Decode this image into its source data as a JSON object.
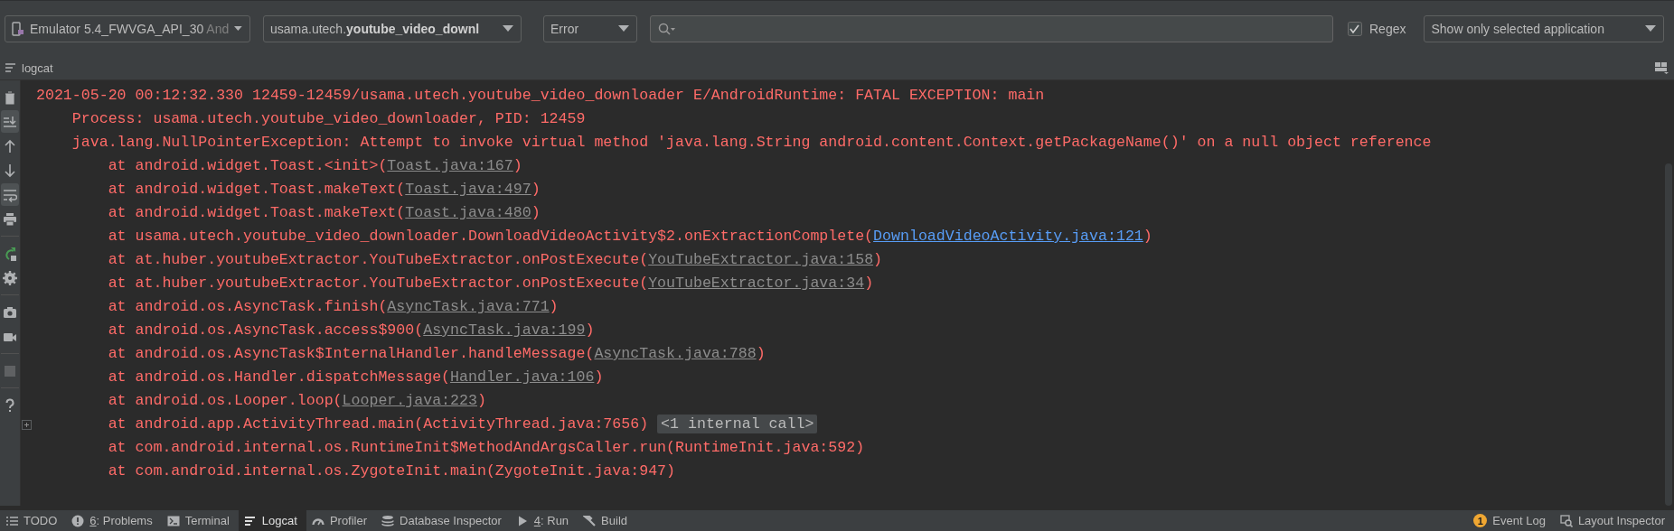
{
  "device_selector": {
    "label": "Emulator 5.4_FWVGA_API_30",
    "cut_text": "And"
  },
  "package_selector": {
    "label": "usama.utech.**youtube_video_downl**"
  },
  "level_selector": {
    "label": "Error"
  },
  "regex": {
    "label": "Regex",
    "checked": true
  },
  "filter_selector": {
    "label": "Show only selected application"
  },
  "panel_title": "logcat",
  "side_tool_groups": [
    [
      {
        "kind": "trash",
        "on": false,
        "disabled": false
      },
      {
        "kind": "scroll-end",
        "on": true,
        "disabled": false
      },
      {
        "kind": "up",
        "on": false,
        "disabled": false
      },
      {
        "kind": "down",
        "on": false,
        "disabled": false
      },
      {
        "kind": "wrap",
        "on": true,
        "disabled": false
      },
      {
        "kind": "print",
        "on": false,
        "disabled": false
      }
    ],
    [
      {
        "kind": "restart",
        "on": false,
        "disabled": false
      },
      {
        "kind": "gear",
        "on": false,
        "disabled": false
      }
    ],
    [
      {
        "kind": "camera",
        "on": false,
        "disabled": false
      },
      {
        "kind": "video",
        "on": false,
        "disabled": false
      }
    ],
    [
      {
        "kind": "stop",
        "on": false,
        "disabled": true
      }
    ],
    [
      {
        "kind": "help",
        "on": false,
        "disabled": false
      }
    ]
  ],
  "log_lines": [
    {
      "kind": "header",
      "text": "2021-05-20 00:12:32.330 12459-12459/usama.utech.youtube_video_downloader E/AndroidRuntime: FATAL EXCEPTION: main",
      "folded": false
    },
    {
      "kind": "cause",
      "text": "Process: usama.utech.youtube_video_downloader, PID: 12459",
      "folded": false
    },
    {
      "kind": "cause",
      "text": "java.lang.NullPointerException: Attempt to invoke virtual method 'java.lang.String android.content.Context.getPackageName()' on a null object reference",
      "folded": false
    },
    {
      "kind": "frame",
      "text": "at android.widget.Toast.<init>(",
      "link": {
        "kind": "library",
        "text": "Toast.java:167"
      },
      "tail": ")",
      "folded": false
    },
    {
      "kind": "frame",
      "text": "at android.widget.Toast.makeText(",
      "link": {
        "kind": "library",
        "text": "Toast.java:497"
      },
      "tail": ")",
      "folded": false
    },
    {
      "kind": "frame",
      "text": "at android.widget.Toast.makeText(",
      "link": {
        "kind": "library",
        "text": "Toast.java:480"
      },
      "tail": ")",
      "folded": false
    },
    {
      "kind": "frame",
      "text": "at usama.utech.youtube_video_downloader.DownloadVideoActivity$2.onExtractionComplete(",
      "link": {
        "kind": "project",
        "text": "DownloadVideoActivity.java:121"
      },
      "tail": ")",
      "folded": false
    },
    {
      "kind": "frame",
      "text": "at at.huber.youtubeExtractor.YouTubeExtractor.onPostExecute(",
      "link": {
        "kind": "library",
        "text": "YouTubeExtractor.java:158"
      },
      "tail": ")",
      "folded": false
    },
    {
      "kind": "frame",
      "text": "at at.huber.youtubeExtractor.YouTubeExtractor.onPostExecute(",
      "link": {
        "kind": "library",
        "text": "YouTubeExtractor.java:34"
      },
      "tail": ")",
      "folded": false
    },
    {
      "kind": "frame",
      "text": "at android.os.AsyncTask.finish(",
      "link": {
        "kind": "library",
        "text": "AsyncTask.java:771"
      },
      "tail": ")",
      "folded": false
    },
    {
      "kind": "frame",
      "text": "at android.os.AsyncTask.access$900(",
      "link": {
        "kind": "library",
        "text": "AsyncTask.java:199"
      },
      "tail": ")",
      "folded": false
    },
    {
      "kind": "frame",
      "text": "at android.os.AsyncTask$InternalHandler.handleMessage(",
      "link": {
        "kind": "library",
        "text": "AsyncTask.java:788"
      },
      "tail": ")",
      "folded": false
    },
    {
      "kind": "frame",
      "text": "at android.os.Handler.dispatchMessage(",
      "link": {
        "kind": "library",
        "text": "Handler.java:106"
      },
      "tail": ")",
      "folded": false
    },
    {
      "kind": "frame",
      "text": "at android.os.Looper.loop(",
      "link": {
        "kind": "library",
        "text": "Looper.java:223"
      },
      "tail": ")",
      "folded": false
    },
    {
      "kind": "frame",
      "text": "at android.app.ActivityThread.main(ActivityThread.java:7656)",
      "badge": "<1 internal call>",
      "folded": true
    },
    {
      "kind": "frame",
      "text": "at com.android.internal.os.RuntimeInit$MethodAndArgsCaller.run(RuntimeInit.java:592)",
      "folded": false
    },
    {
      "kind": "frame",
      "text": "at com.android.internal.os.ZygoteInit.main(ZygoteInit.java:947)",
      "folded": false
    }
  ],
  "tool_windows": [
    {
      "kind": "todo",
      "label": "TODO",
      "selected": false
    },
    {
      "kind": "problems",
      "key": "6",
      "label": ": Problems",
      "selected": false
    },
    {
      "kind": "terminal",
      "label": "Terminal",
      "selected": false
    },
    {
      "kind": "logcat",
      "label": "Logcat",
      "selected": true
    },
    {
      "kind": "profiler",
      "label": "Profiler",
      "selected": false
    },
    {
      "kind": "database",
      "label": "Database Inspector",
      "selected": false
    },
    {
      "kind": "run",
      "key": "4",
      "label": ": Run",
      "selected": false
    },
    {
      "kind": "build",
      "label": "Build",
      "selected": false
    }
  ],
  "status_items": [
    {
      "kind": "events",
      "count": "1",
      "label": "Event Log"
    },
    {
      "kind": "inspector",
      "label": "Layout Inspector"
    }
  ]
}
